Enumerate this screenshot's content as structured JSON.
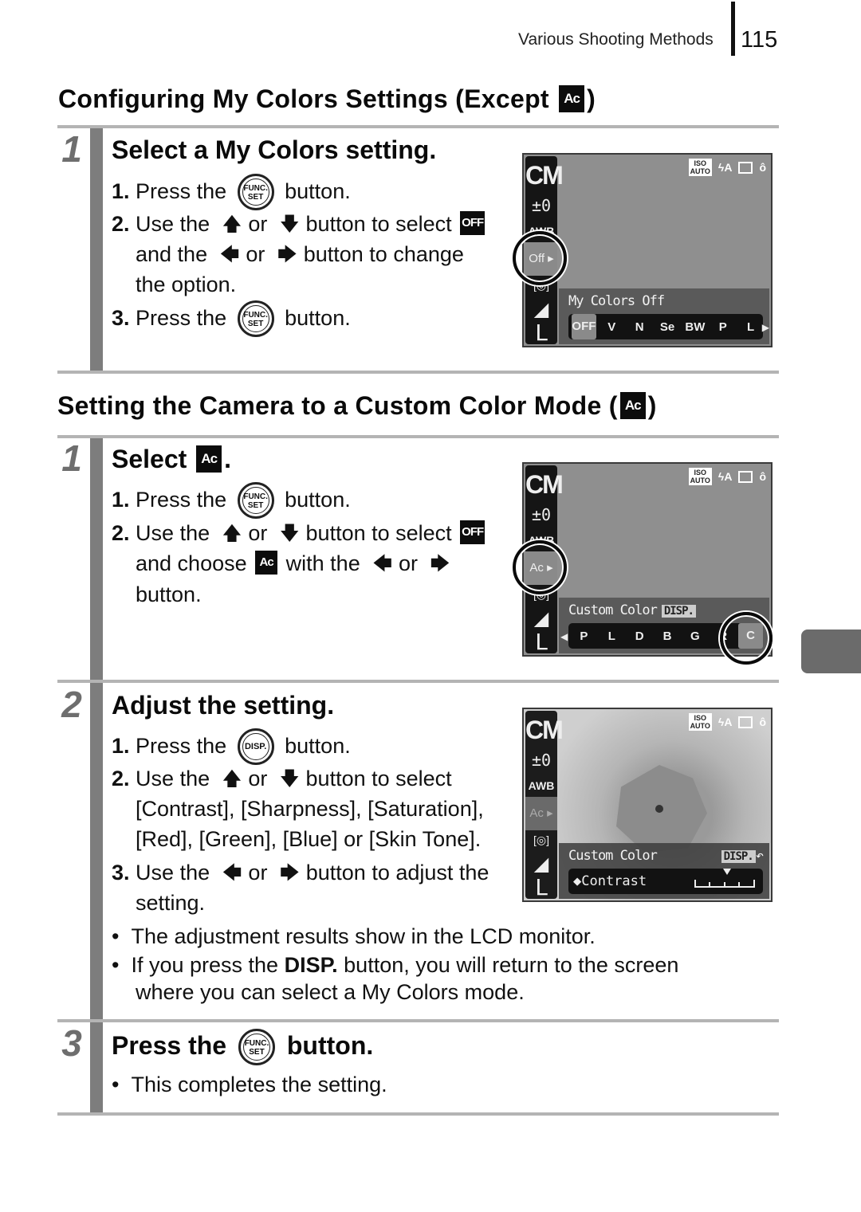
{
  "header": {
    "running_head": "Various Shooting Methods",
    "page_number": "115"
  },
  "section1": {
    "title_prefix": "Configuring My Colors Settings (Except",
    "title_icon": "custom-color-icon",
    "title_icon_text": "Ac",
    "title_suffix": ")",
    "step1": {
      "number": "1",
      "title": "Select a My Colors setting.",
      "items": [
        {
          "num": "1.",
          "pre": "Press the",
          "button": "FUNC./SET",
          "post": "button."
        },
        {
          "num": "2.",
          "l1_pre": "Use the",
          "or": "or",
          "l1_post": "button to select",
          "icon_text": "OFF",
          "l2_pre": "and the",
          "l2_post": "button to change",
          "l3": "the option."
        },
        {
          "num": "3.",
          "pre": "Press the",
          "button": "FUNC./SET",
          "post": "button."
        }
      ],
      "lcd": {
        "mode": "CM",
        "ev": "±0",
        "wb": "AWB",
        "selected_menu": "Off ▸",
        "size": "L",
        "top_icons": [
          "ISO AUTO",
          "Flash Auto",
          "Frame",
          "Self-timer"
        ],
        "label": "My Colors Off",
        "options": [
          "OFF",
          "V",
          "N",
          "Se",
          "BW",
          "P",
          "L"
        ],
        "selected_option": "OFF"
      }
    }
  },
  "section2": {
    "title_prefix": "Setting the Camera to a Custom Color Mode (",
    "title_icon": "custom-color-icon",
    "title_icon_text": "Ac",
    "title_suffix": ")",
    "step1": {
      "number": "1",
      "title_pre": "Select",
      "title_post": ".",
      "items": [
        {
          "num": "1.",
          "pre": "Press the",
          "button": "FUNC./SET",
          "post": "button."
        },
        {
          "num": "2.",
          "l1_pre": "Use the",
          "or": "or",
          "l1_post": "button to select",
          "icon_text": "OFF",
          "l2_pre": "and choose",
          "l2_mid": "with the",
          "l3": "button."
        }
      ],
      "lcd": {
        "mode": "CM",
        "ev": "±0",
        "wb": "AWB",
        "selected_menu": "Ac ▸",
        "size": "L",
        "label": "Custom Color",
        "disp_tag": "DISP.",
        "options": [
          "P",
          "L",
          "D",
          "B",
          "G",
          "R",
          "C"
        ],
        "selected_option": "C"
      }
    },
    "step2": {
      "number": "2",
      "title": "Adjust the setting.",
      "items": [
        {
          "num": "1.",
          "pre": "Press the",
          "button": "DISP.",
          "post": "button."
        },
        {
          "num": "2.",
          "l1_pre": "Use the",
          "or": "or",
          "l1_post": "button to select",
          "l2": "[Contrast], [Sharpness], [Saturation],",
          "l3": "[Red], [Green], [Blue] or [Skin Tone]."
        },
        {
          "num": "3.",
          "l1_pre": "Use the",
          "or": "or",
          "l1_post": "button to adjust the",
          "l2": "setting."
        }
      ],
      "bullets": [
        {
          "text": "The adjustment results show in the LCD monitor."
        },
        {
          "pre": "If you press the",
          "bold": "DISP.",
          "post": "button, you will return to the screen",
          "l2": "where you can select a My Colors mode."
        }
      ],
      "lcd": {
        "mode": "CM",
        "ev": "±0",
        "wb": "AWB",
        "size": "L",
        "label": "Custom Color",
        "disp_tag": "DISP.",
        "back": "↶",
        "param": "◆Contrast",
        "contrast_level": "0 (center of 5)"
      }
    },
    "step3": {
      "number": "3",
      "title_pre": "Press the",
      "button": "FUNC./SET",
      "title_post": "button.",
      "bullets": [
        "This completes the setting."
      ]
    }
  },
  "icons": {
    "up": "🡅",
    "down": "🡇",
    "left": "🡄",
    "right": "🡆"
  }
}
